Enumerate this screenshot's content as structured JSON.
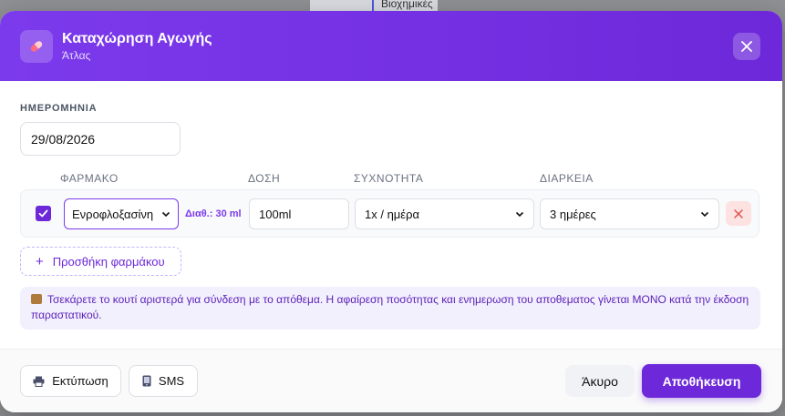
{
  "background": {
    "partial_text": "Βιοχημικές"
  },
  "modal": {
    "title": "Καταχώρηση Αγωγής",
    "subtitle": "Άτλας",
    "icon": "pill-icon",
    "close_icon": "close-icon"
  },
  "date": {
    "label": "ΗΜΕΡΟΜΗΝΙΑ",
    "value": "29/08/2026"
  },
  "columns": {
    "drug": "ΦΑΡΜΑΚΟ",
    "dose": "ΔΟΣΗ",
    "frequency": "ΣΥΧΝΟΤΗΤΑ",
    "duration": "ΔΙΑΡΚΕΙΑ"
  },
  "medications": [
    {
      "checked": true,
      "drug": "Ενροφλοξασίνη",
      "available": "Διαθ.: 30 ml",
      "dose": "100ml",
      "frequency": "1x / ημέρα",
      "duration": "3 ημέρες"
    }
  ],
  "add_medication_label": "Προσθήκη φαρμάκου",
  "info_text": "Τσεκάρετε το κουτί αριστερά για σύνδεση με το απόθεμα. Η αφαίρεση ποσότητας και ενημερωση του αποθεματος γίνεται ΜΟΝΟ κατά την έκδοση παραστατικού.",
  "footer": {
    "print_label": "Εκτύπωση",
    "sms_label": "SMS",
    "cancel_label": "Άκυρο",
    "save_label": "Αποθήκευση"
  },
  "colors": {
    "accent": "#6d28d9",
    "danger_bg": "#fde2e2",
    "info_bg": "#f3f0fe"
  }
}
